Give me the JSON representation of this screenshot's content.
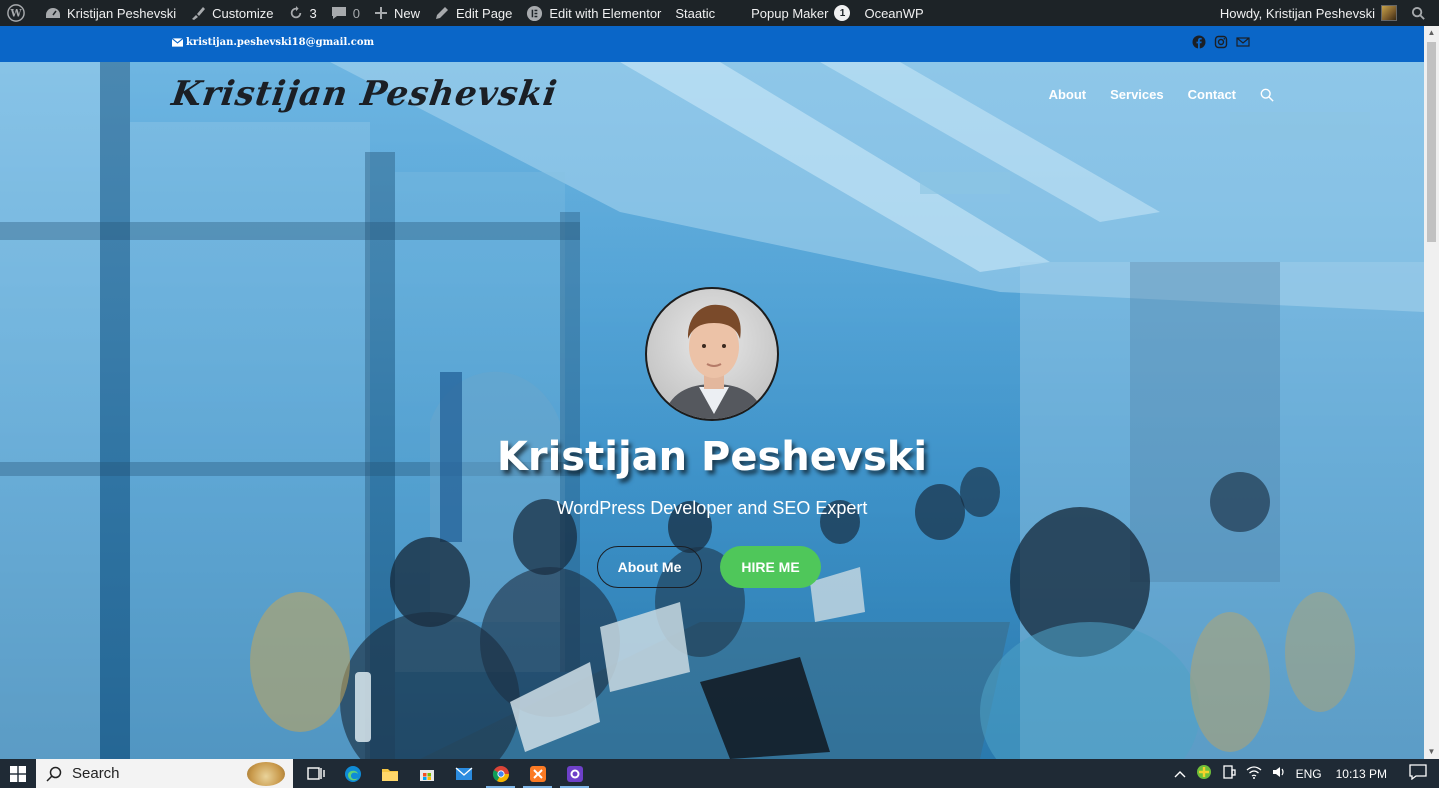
{
  "adminbar": {
    "site_name": "Kristijan Peshevski",
    "customize": "Customize",
    "updates_count": "3",
    "comments_count": "0",
    "new_label": "New",
    "edit_page": "Edit Page",
    "edit_elementor": "Edit with Elementor",
    "staatic": "Staatic",
    "popup_maker": "Popup Maker",
    "popup_badge": "1",
    "oceanwp": "OceanWP",
    "howdy": "Howdy, Kristijan Peshevski"
  },
  "topbar": {
    "email": "kristijan.peshevski18@gmail.com",
    "social": [
      "facebook-icon",
      "instagram-icon",
      "mail-icon"
    ]
  },
  "header": {
    "logo": "Kristijan Peshevski",
    "nav": [
      "About",
      "Services",
      "Contact"
    ]
  },
  "hero": {
    "name": "Kristijan Peshevski",
    "subtitle": "WordPress Developer and SEO Expert",
    "btn_about": "About Me",
    "btn_hire": "HIRE ME"
  },
  "taskbar": {
    "search_label": "Search",
    "lang": "ENG",
    "time": "10:13 PM"
  },
  "colors": {
    "adminbar": "#1d2327",
    "topbar": "#0a66c8",
    "hire_button": "#4fc75a"
  }
}
